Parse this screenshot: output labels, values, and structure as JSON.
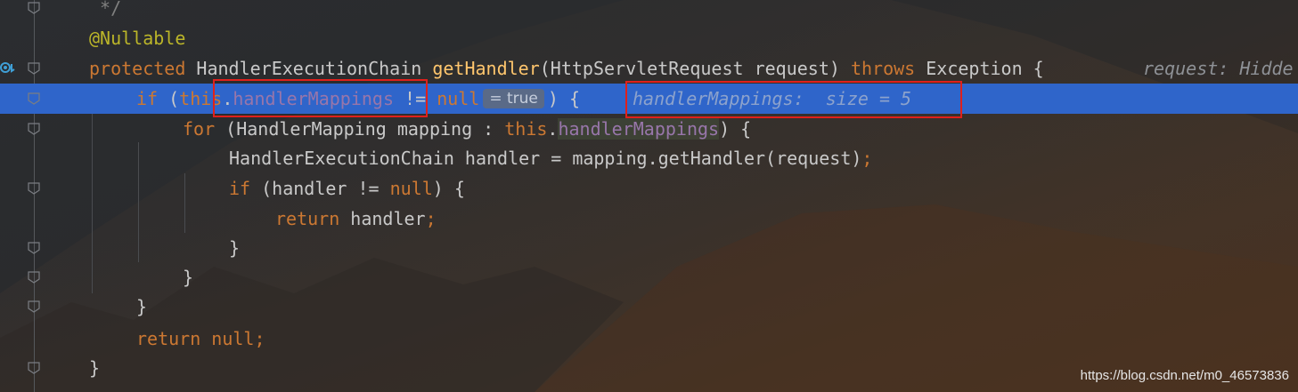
{
  "editor": {
    "lines": [
      {
        "tokens": [
          {
            "t": " */",
            "c": "cmt"
          }
        ]
      },
      {
        "tokens": [
          {
            "t": "@Nullable",
            "c": "ann"
          }
        ]
      },
      {
        "tokens": [
          {
            "t": "protected ",
            "c": "kw"
          },
          {
            "t": "HandlerExecutionChain ",
            "c": ""
          },
          {
            "t": "getHandler",
            "c": "fn"
          },
          {
            "t": "(HttpServletRequest request) ",
            "c": ""
          },
          {
            "t": "throws ",
            "c": "kw"
          },
          {
            "t": "Exception {",
            "c": ""
          }
        ],
        "hint": "request: Hidde"
      },
      {
        "tokens": [
          {
            "t": "if ",
            "c": "kw"
          },
          {
            "t": "(",
            "c": ""
          },
          {
            "t": "this",
            "c": "kw"
          },
          {
            "t": ".",
            "c": ""
          },
          {
            "t": "handlerMappings",
            "c": "fld"
          },
          {
            "t": " != ",
            "c": ""
          },
          {
            "t": "null",
            "c": "kw"
          }
        ],
        "chip": "= true",
        "after": ") {",
        "hint": "handlerMappings:  size = 5"
      },
      {
        "tokens": [
          {
            "t": "for ",
            "c": "kw"
          },
          {
            "t": "(HandlerMapping mapping : ",
            "c": ""
          },
          {
            "t": "this",
            "c": "kw"
          },
          {
            "t": ".",
            "c": ""
          },
          {
            "t": "handlerMappings",
            "c": "fld"
          },
          {
            "t": ") {",
            "c": ""
          }
        ]
      },
      {
        "tokens": [
          {
            "t": "HandlerExecutionChain handler = mapping.getHandler(request)",
            "c": ""
          },
          {
            "t": ";",
            "c": "kw"
          }
        ]
      },
      {
        "tokens": [
          {
            "t": "if ",
            "c": "kw"
          },
          {
            "t": "(handler != ",
            "c": ""
          },
          {
            "t": "null",
            "c": "kw"
          },
          {
            "t": ") {",
            "c": ""
          }
        ]
      },
      {
        "tokens": [
          {
            "t": "return ",
            "c": "kw"
          },
          {
            "t": "handler",
            "c": ""
          },
          {
            "t": ";",
            "c": "kw"
          }
        ]
      },
      {
        "tokens": [
          {
            "t": "}",
            "c": ""
          }
        ]
      },
      {
        "tokens": [
          {
            "t": "}",
            "c": ""
          }
        ]
      },
      {
        "tokens": [
          {
            "t": "}",
            "c": ""
          }
        ]
      },
      {
        "tokens": [
          {
            "t": "return null",
            "c": "kw"
          },
          {
            "t": ";",
            "c": "kw"
          }
        ]
      },
      {
        "tokens": [
          {
            "t": "}",
            "c": ""
          }
        ]
      }
    ]
  },
  "watermark": "https://blog.csdn.net/m0_46573836",
  "colors": {
    "highlight": "#2f65ca",
    "keyword": "#cc7832",
    "annotation": "#bbb529",
    "method": "#ffc66d",
    "field": "#9876aa",
    "callout": "#e0201b"
  }
}
